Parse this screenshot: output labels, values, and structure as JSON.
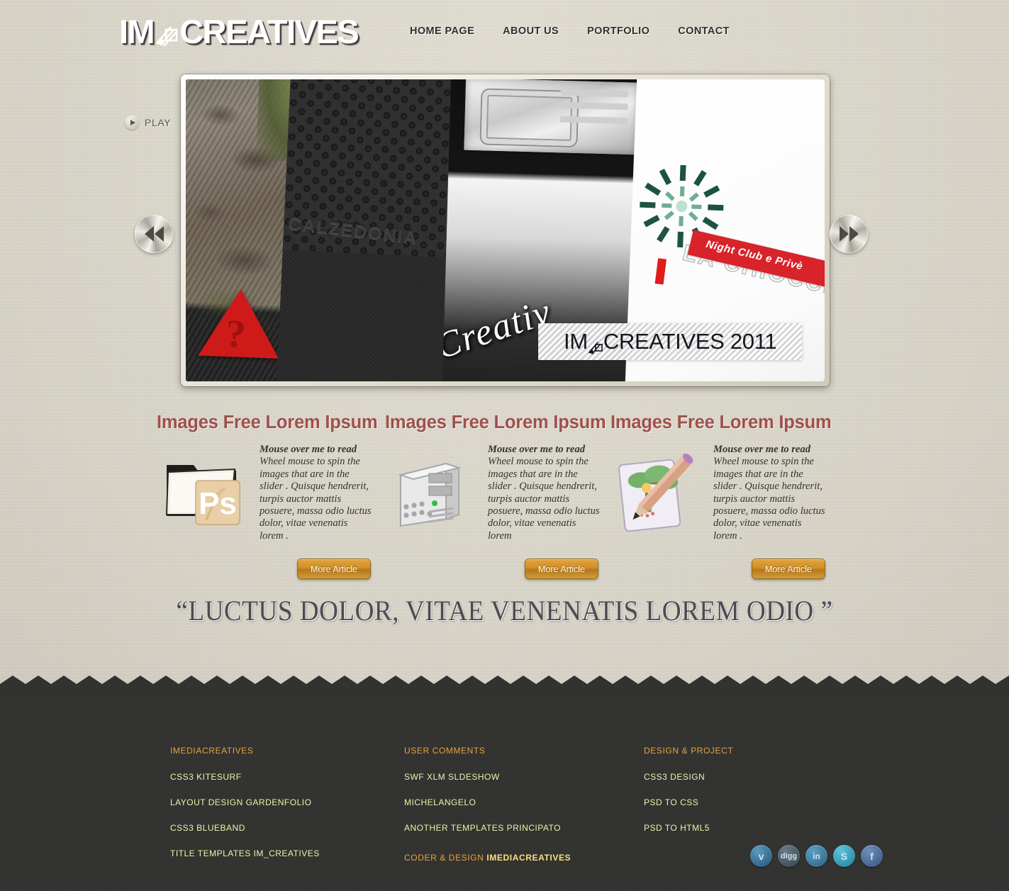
{
  "site": {
    "logo_prefix": "IM",
    "logo_suffix": "CREATIVES",
    "logo_icon": "easel-drawing-icon"
  },
  "nav": {
    "items": [
      {
        "label": "HOME PAGE"
      },
      {
        "label": "ABOUT US"
      },
      {
        "label": "PORTFOLIO"
      },
      {
        "label": "CONTACT"
      }
    ]
  },
  "slider": {
    "play_label": "PLAY",
    "play_icon": "play-triangle-icon",
    "prev_icon": "double-left-arrow-icon",
    "next_icon": "double-right-arrow-icon",
    "caption_prefix": "IM",
    "caption_suffix": "CREATIVES 2011",
    "slides": [
      {
        "name": "tree-photo-slide",
        "alt_text": "?"
      },
      {
        "name": "calzedonia-slide",
        "alt_text": "CALZEDONIA"
      },
      {
        "name": "creative-grayscale-slide",
        "alt_text": "Creativ"
      },
      {
        "name": "night-club-flyer-slide",
        "alt_text": "Night Club e Privè",
        "sub_text": "LA CHIOCCIOLA"
      }
    ]
  },
  "columns": [
    {
      "title": "Images Free Lorem Ipsum",
      "icon": "photoshop-folder-icon",
      "lead": "Mouse over me to read",
      "body": "Wheel mouse to spin the images that are in the slider . Quisque hendrerit, turpis auctor mattis posuere, massa odio luctus dolor, vitae venenatis lorem .",
      "button": "More Article"
    },
    {
      "title": "Images Free Lorem Ipsum",
      "icon": "computer-tower-icon",
      "lead": "Mouse over me to read",
      "body": "Wheel mouse to spin the images that are in the slider . Quisque hendrerit, turpis auctor mattis posuere, massa odio luctus dolor, vitae venenatis lorem",
      "button": "More Article"
    },
    {
      "title": "Images Free Lorem Ipsum",
      "icon": "drawing-pencil-icon",
      "lead": "Mouse over me to read",
      "body": "Wheel mouse to spin the images that are in the slider . Quisque hendrerit, turpis auctor mattis posuere, massa odio luctus dolor, vitae venenatis lorem .",
      "button": "More Article"
    }
  ],
  "quote": "“LUCTUS DOLOR, VITAE VENENATIS LOREM ODIO ”",
  "footer": {
    "columns": [
      {
        "heading": "IMEDIACREATIVES",
        "links": [
          "CSS3 KITESURF",
          "LAYOUT DESIGN GARDENFOLIO",
          "CSS3 BLUEBAND",
          "TITLE TEMPLATES IM_CREATIVES"
        ]
      },
      {
        "heading": "USER COMMENTS",
        "links": [
          "SWF XLM SLDESHOW",
          "MICHELANGELO",
          "ANOTHER TEMPLATES PRINCIPATO"
        ]
      },
      {
        "heading": "DESIGN & PROJECT",
        "links": [
          "CSS3 DESIGN",
          "PSD TO CSS",
          "PSD TO HTML5"
        ]
      }
    ],
    "credit_prefix": "CODER & DESIGN ",
    "credit_name": "IMEDIACREATIVES",
    "socials": [
      {
        "name": "vimeo-icon",
        "glyph": "v"
      },
      {
        "name": "digg-icon",
        "glyph": "digg"
      },
      {
        "name": "linkedin-icon",
        "glyph": "in"
      },
      {
        "name": "skype-icon",
        "glyph": "S"
      },
      {
        "name": "facebook-icon",
        "glyph": "f"
      }
    ]
  },
  "colors": {
    "page_bg": "#d9d4c6",
    "footer_bg": "#323230",
    "heading": "#a0504c",
    "footer_heading": "#e8a33a",
    "footer_link": "#f0f2a8",
    "button": "#d08f27"
  }
}
